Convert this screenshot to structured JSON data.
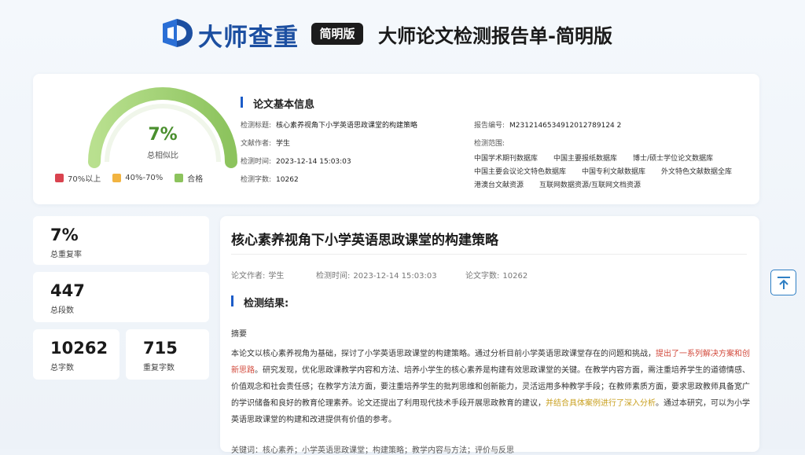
{
  "header": {
    "brand": "大师查重",
    "badge": "简明版",
    "title": "大师论文检测报告单-简明版"
  },
  "gauge": {
    "percent": "7%",
    "percent_value": 0.07,
    "label": "总相似比",
    "legend": [
      {
        "label": "70%以上",
        "color": "#d9434f"
      },
      {
        "label": "40%-70%",
        "color": "#f2b441"
      },
      {
        "label": "合格",
        "color": "#8cc35d"
      }
    ]
  },
  "basic_info": {
    "section_title": "论文基本信息",
    "title_label": "检测标题:",
    "title_value": "核心素养视角下小学英语思政课堂的构建策略",
    "author_label": "文献作者:",
    "author_value": "学生",
    "time_label": "检测时间:",
    "time_value": "2023-12-14 15:03:03",
    "words_label": "检测字数:",
    "words_value": "10262",
    "report_label": "报告编号:",
    "report_value": "M2312146534912012789124 2",
    "scope_label": "检测范围:",
    "scope": [
      [
        "中国学术期刊数据库",
        "中国主要报纸数据库",
        "博士/硕士学位论文数据库"
      ],
      [
        "中国主要会议论文特色数据库",
        "中国专利文献数据库",
        "外文特色文献数据全库"
      ],
      [
        "港澳台文献资源",
        "互联网数据资源/互联网文档资源"
      ]
    ]
  },
  "stats": {
    "repeat_rate": {
      "value": "7%",
      "label": "总重复率"
    },
    "paragraphs": {
      "value": "447",
      "label": "总段数"
    },
    "words": {
      "value": "10262",
      "label": "总字数"
    },
    "repeat_words": {
      "value": "715",
      "label": "重复字数"
    }
  },
  "paper": {
    "title": "核心素养视角下小学英语思政课堂的构建策略",
    "author_label": "论文作者:",
    "author": "学生",
    "time_label": "检测时间:",
    "time": "2023-12-14 15:03:03",
    "words_label": "论文字数:",
    "words": "10262",
    "result_title": "检测结果:",
    "abstract_label": "摘要",
    "abstract_1": "本论文以核心素养视角为基础，探讨了小学英语思政课堂的构建策略。通过分析目前小学英语思政课堂存在的问题和挑战，",
    "abstract_hl1": "提出了一系列解决方案和创新思路",
    "abstract_2": "。研究发现，优化思政课教学内容和方法、培养小学生的核心素养是构建有效思政课堂的关键。在教学内容方面，需注重培养学生的道德情感、价值观念和社会责任感；在教学方法方面，要注重培养学生的批判思维和创新能力，灵活运用多种教学手段；在教师素质方面，要求思政教师具备宽广的学识储备和良好的教育伦理素养。论文还提出了利用现代技术手段开展思政教育的建议，",
    "abstract_hl2": "并结合具体案例进行了深入分析",
    "abstract_3": "。通过本研究，可以为小学英语思政课堂的构建和改进提供有价值的参考。",
    "keywords_cut": "关键词：核心素养；小学英语思政课堂；构建策略；教学内容与方法；评价与反思"
  }
}
